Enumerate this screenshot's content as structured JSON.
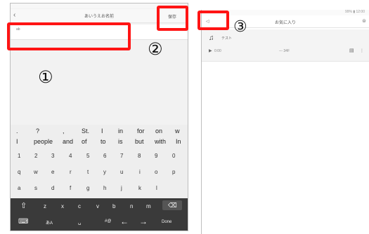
{
  "left": {
    "back_icon": "chevron-left-icon",
    "title": "あいうえお名前",
    "save": "保存",
    "input_value": "ab",
    "suggestions_top": [
      ".",
      "?",
      ",",
      "St.",
      "I",
      "in",
      "for",
      "on",
      "w"
    ],
    "suggestions_bottom": [
      "I",
      "people",
      "and",
      "of",
      "to",
      "is",
      "but",
      "with",
      "In"
    ],
    "digits": [
      "1",
      "2",
      "3",
      "4",
      "5",
      "6",
      "7",
      "8",
      "9",
      "0"
    ],
    "row_q": [
      "q",
      "w",
      "e",
      "r",
      "t",
      "y",
      "u",
      "i",
      "o",
      "p"
    ],
    "row_a": [
      "a",
      "s",
      "d",
      "f",
      "g",
      "h",
      "j",
      "k",
      "l"
    ],
    "row_z": [
      "z",
      "x",
      "c",
      "v",
      "b",
      "n",
      "m"
    ],
    "lang_key": "あA",
    "sym_key": "#@",
    "done": "Done"
  },
  "right": {
    "status": "99% ▮ 12:00",
    "back": "◁",
    "title": "お気に入り",
    "song_name": "テスト",
    "song_time": "0:00",
    "song_dash": "--- 34F",
    "more": "⋮"
  },
  "annotations": [
    "①",
    "②",
    "③"
  ]
}
